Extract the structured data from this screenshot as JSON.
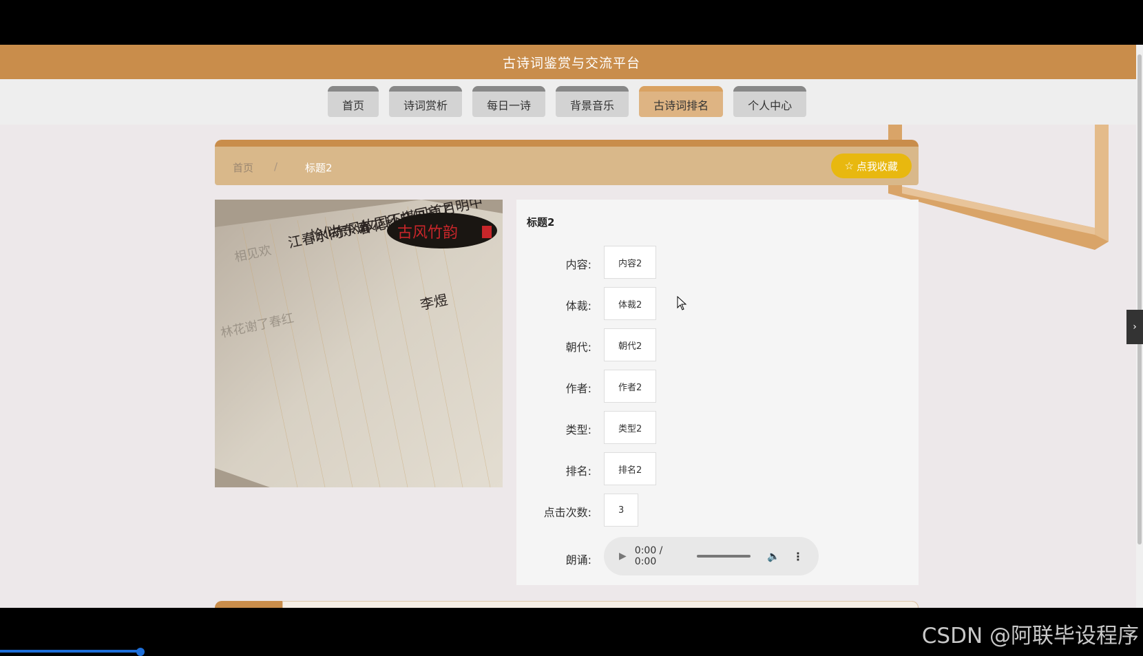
{
  "header": {
    "title": "古诗词鉴赏与交流平台"
  },
  "nav": {
    "items": [
      {
        "label": "首页"
      },
      {
        "label": "诗词赏析"
      },
      {
        "label": "每日一诗"
      },
      {
        "label": "背景音乐"
      },
      {
        "label": "古诗词排名",
        "active": true
      },
      {
        "label": "个人中心"
      }
    ]
  },
  "breadcrumb": {
    "home": "首页",
    "separator": "/",
    "current": "标题2"
  },
  "favorite": {
    "label": "点我收藏",
    "icon": "star-icon"
  },
  "image": {
    "logo_text": "古风竹韵"
  },
  "detail": {
    "title": "标题2",
    "fields": [
      {
        "label": "内容:",
        "value": "内容2"
      },
      {
        "label": "体裁:",
        "value": "体裁2"
      },
      {
        "label": "朝代:",
        "value": "朝代2"
      },
      {
        "label": "作者:",
        "value": "作者2"
      },
      {
        "label": "类型:",
        "value": "类型2"
      },
      {
        "label": "排名:",
        "value": "排名2"
      },
      {
        "label": "点击次数:",
        "value": "3"
      }
    ],
    "audio": {
      "label": "朗诵:",
      "time": "0:00 / 0:00"
    }
  },
  "watermark": "CSDN @阿联毕设程序",
  "colors": {
    "brand": "#c98d4b",
    "crumb_bar": "#d9b88a",
    "favorite": "#e8b80f",
    "active_tab": "#deb483"
  }
}
